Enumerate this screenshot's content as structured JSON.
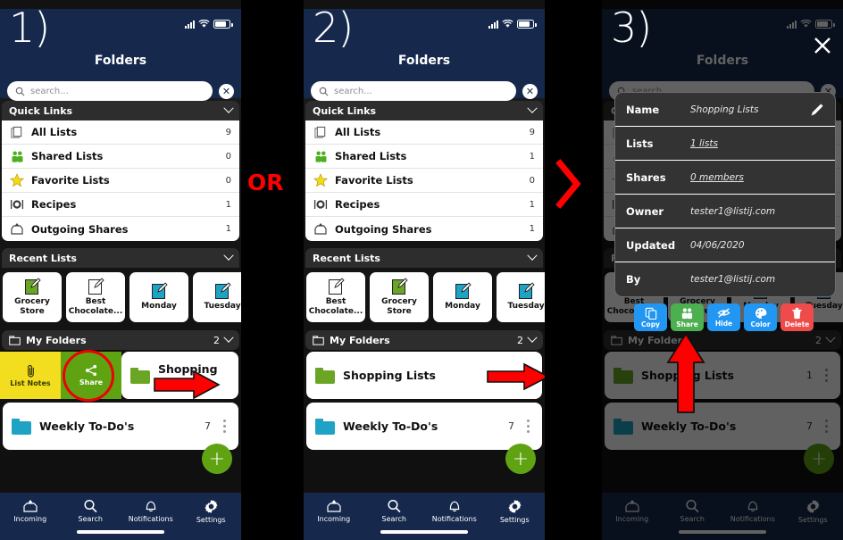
{
  "annotations": {
    "or_label": "OR",
    "chevron": "chevron-right",
    "step1": "1)",
    "step2": "2)",
    "step3": "3)"
  },
  "colors": {
    "header_navy": "#16294d",
    "accent_green": "#5fa313",
    "annotation_red": "#ff0000",
    "section_gray": "#2d2d2d",
    "modal_gray": "#333333",
    "swipe_yellow": "#f2dd1f",
    "delete_red": "#ef4b4b",
    "action_blue": "#2196f3",
    "folder_green": "#6aa525",
    "folder_cyan": "#1fa3c4"
  },
  "panel1": {
    "step": "1)",
    "header": {
      "title": "Folders"
    },
    "search": {
      "placeholder": "search...",
      "clear_label": "✕"
    },
    "quick_links": {
      "title": "Quick Links",
      "items": [
        {
          "label": "All Lists",
          "count": "9",
          "icon": "stacked-pages-icon"
        },
        {
          "label": "Shared Lists",
          "count": "0",
          "icon": "people-icon"
        },
        {
          "label": "Favorite Lists",
          "count": "0",
          "icon": "star-icon"
        },
        {
          "label": "Recipes",
          "count": "1",
          "icon": "plate-icon"
        },
        {
          "label": "Outgoing Shares",
          "count": "1",
          "icon": "outbox-icon"
        }
      ]
    },
    "recent_lists": {
      "title": "Recent Lists",
      "cards": [
        {
          "name": "Grocery Store",
          "color": "#6aa525"
        },
        {
          "name": "Best Chocolate...",
          "color": "#ffffff"
        },
        {
          "name": "Monday",
          "color": "#1fa3c4"
        },
        {
          "name": "Tuesday",
          "color": "#1fa3c4"
        }
      ]
    },
    "my_folders": {
      "title": "My Folders",
      "count": "2",
      "rows": [
        {
          "name": "Shopping Lists",
          "count": "",
          "color": "#6aa525"
        },
        {
          "name": "Weekly To-Do's",
          "count": "7",
          "color": "#1fa3c4"
        }
      ]
    },
    "swipe_actions": [
      {
        "label": "List Notes",
        "icon": "paperclip-icon",
        "bg": "#f2dd1f"
      },
      {
        "label": "Share",
        "icon": "share-icon",
        "bg": "#5fa313"
      }
    ],
    "fab_label": "+",
    "bottom_nav": [
      {
        "label": "Incoming",
        "icon": "inbox-icon"
      },
      {
        "label": "Search",
        "icon": "search-icon"
      },
      {
        "label": "Notifications",
        "icon": "bell-icon"
      },
      {
        "label": "Settings",
        "icon": "gear-icon"
      }
    ]
  },
  "panel2": {
    "step": "2)",
    "header": {
      "title": "Folders"
    },
    "search": {
      "placeholder": "search...",
      "clear_label": "✕"
    },
    "quick_links": {
      "title": "Quick Links",
      "items": [
        {
          "label": "All Lists",
          "count": "9",
          "icon": "stacked-pages-icon"
        },
        {
          "label": "Shared Lists",
          "count": "1",
          "icon": "people-icon"
        },
        {
          "label": "Favorite Lists",
          "count": "0",
          "icon": "star-icon"
        },
        {
          "label": "Recipes",
          "count": "1",
          "icon": "plate-icon"
        },
        {
          "label": "Outgoing Shares",
          "count": "1",
          "icon": "outbox-icon"
        }
      ]
    },
    "recent_lists": {
      "title": "Recent Lists",
      "cards": [
        {
          "name": "Best Chocolate...",
          "color": "#ffffff"
        },
        {
          "name": "Grocery Store",
          "color": "#6aa525"
        },
        {
          "name": "Monday",
          "color": "#1fa3c4"
        },
        {
          "name": "Tuesday",
          "color": "#1fa3c4"
        }
      ]
    },
    "my_folders": {
      "title": "My Folders",
      "count": "2",
      "rows": [
        {
          "name": "Shopping Lists",
          "count": "",
          "color": "#6aa525"
        },
        {
          "name": "Weekly To-Do's",
          "count": "7",
          "color": "#1fa3c4"
        }
      ]
    },
    "fab_label": "+",
    "bottom_nav": [
      {
        "label": "Incoming",
        "icon": "inbox-icon"
      },
      {
        "label": "Search",
        "icon": "search-icon"
      },
      {
        "label": "Notifications",
        "icon": "bell-icon"
      },
      {
        "label": "Settings",
        "icon": "gear-icon"
      }
    ]
  },
  "panel3": {
    "step": "3)",
    "header": {
      "title": "Folders"
    },
    "search": {
      "placeholder": "search...",
      "clear_label": "✕"
    },
    "close_label": "✕",
    "detail_modal": {
      "rows": [
        {
          "label": "Name",
          "value": "Shopping Lists",
          "link": false,
          "edit_icon": "pencil-icon"
        },
        {
          "label": "Lists",
          "value": "1 lists",
          "link": true
        },
        {
          "label": "Shares",
          "value": "0 members",
          "link": true
        },
        {
          "label": "Owner",
          "value": "tester1@listij.com",
          "link": false
        },
        {
          "label": "Updated",
          "value": "04/06/2020",
          "link": false
        },
        {
          "label": "By",
          "value": "tester1@listij.com",
          "link": false
        }
      ]
    },
    "action_buttons": [
      {
        "label": "Copy",
        "icon": "copy-icon",
        "bg": "#2196f3"
      },
      {
        "label": "Share",
        "icon": "share-people-icon",
        "bg": "#4caf50"
      },
      {
        "label": "Hide",
        "icon": "eye-off-icon",
        "bg": "#2196f3"
      },
      {
        "label": "Color",
        "icon": "palette-icon",
        "bg": "#2196f3"
      },
      {
        "label": "Delete",
        "icon": "trash-icon",
        "bg": "#ef4b4b"
      }
    ],
    "recent_lists": {
      "title": "Recent Lists",
      "cards": [
        {
          "name": "Best Chocolate...",
          "color": "#ffffff"
        },
        {
          "name": "Grocery Store",
          "color": "#6aa525"
        },
        {
          "name": "Monday",
          "color": "#1fa3c4"
        },
        {
          "name": "Tuesday",
          "color": "#1fa3c4"
        }
      ]
    },
    "my_folders": {
      "title": "My Folders",
      "count": "2",
      "rows": [
        {
          "name": "Shopping Lists",
          "count": "1",
          "color": "#6aa525"
        },
        {
          "name": "Weekly To-Do's",
          "count": "7",
          "color": "#1fa3c4"
        }
      ]
    },
    "fab_label": "+",
    "bottom_nav": [
      {
        "label": "Incoming",
        "icon": "inbox-icon"
      },
      {
        "label": "Search",
        "icon": "search-icon"
      },
      {
        "label": "Notifications",
        "icon": "bell-icon"
      },
      {
        "label": "Settings",
        "icon": "gear-icon"
      }
    ]
  }
}
